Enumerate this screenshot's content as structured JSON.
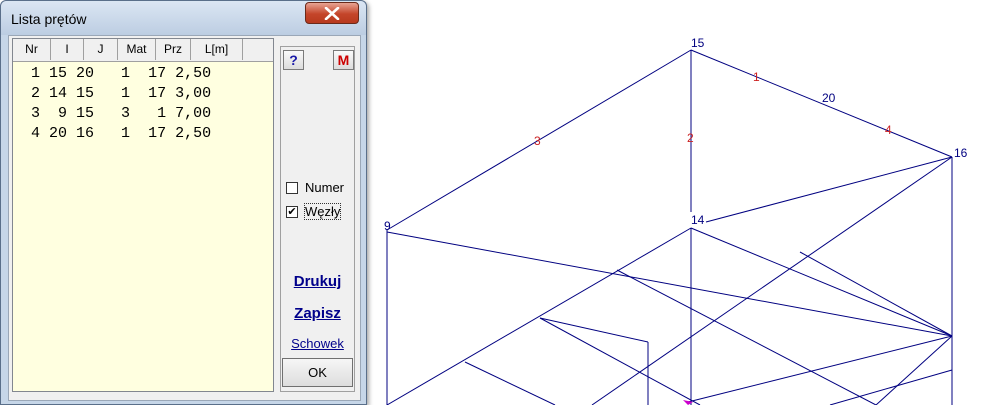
{
  "window": {
    "title": "Lista prętów",
    "close_icon": "close-icon"
  },
  "table": {
    "headers": [
      "Nr",
      "I",
      "J",
      "Mat",
      "Prz",
      "L[m]"
    ],
    "rows": [
      {
        "nr": "1",
        "i": "15",
        "j": "20",
        "mat": "1",
        "prz": "17",
        "l": "2,50"
      },
      {
        "nr": "2",
        "i": "14",
        "j": "15",
        "mat": "1",
        "prz": "17",
        "l": "3,00"
      },
      {
        "nr": "3",
        "i": "9",
        "j": "15",
        "mat": "3",
        "prz": "1",
        "l": "7,00"
      },
      {
        "nr": "4",
        "i": "20",
        "j": "16",
        "mat": "1",
        "prz": "17",
        "l": "2,50"
      }
    ]
  },
  "side": {
    "help_label": "?",
    "m_label": "M",
    "numer_label": "Numer",
    "numer_checked": false,
    "wezly_label": "Węzły",
    "wezly_checked": true,
    "drukuj_label": "Drukuj",
    "zapisz_label": "Zapisz",
    "schowek_label": "Schowek",
    "ok_label": "OK"
  },
  "drawing": {
    "node_labels": [
      "15",
      "16",
      "14",
      "9"
    ],
    "bar_labels": [
      "1",
      "20",
      "4",
      "3",
      "2"
    ],
    "node_color": "#000080",
    "bar_label_color": "#cc2222",
    "line_color": "#000080"
  }
}
